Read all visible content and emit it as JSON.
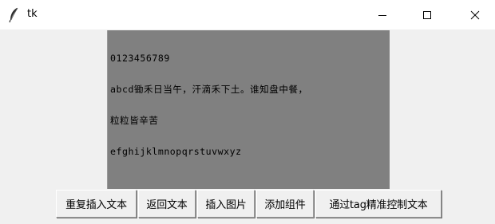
{
  "window": {
    "title": "tk",
    "icons": {
      "app": "feather-icon",
      "minimize": "minimize-icon",
      "maximize": "maximize-icon",
      "close": "close-icon"
    }
  },
  "text_widget": {
    "background": "#808080",
    "lines": [
      "0123456789",
      "abcd锄禾日当午，汗滴禾下土。谁知盘中餐，",
      "粒粒皆辛苦",
      "efghijklmnopqrstuvwxyz"
    ]
  },
  "buttons": [
    {
      "label": "重复插入文本"
    },
    {
      "label": "返回文本"
    },
    {
      "label": "插入图片"
    },
    {
      "label": "添加组件"
    },
    {
      "label": "通过tag精准控制文本"
    }
  ]
}
